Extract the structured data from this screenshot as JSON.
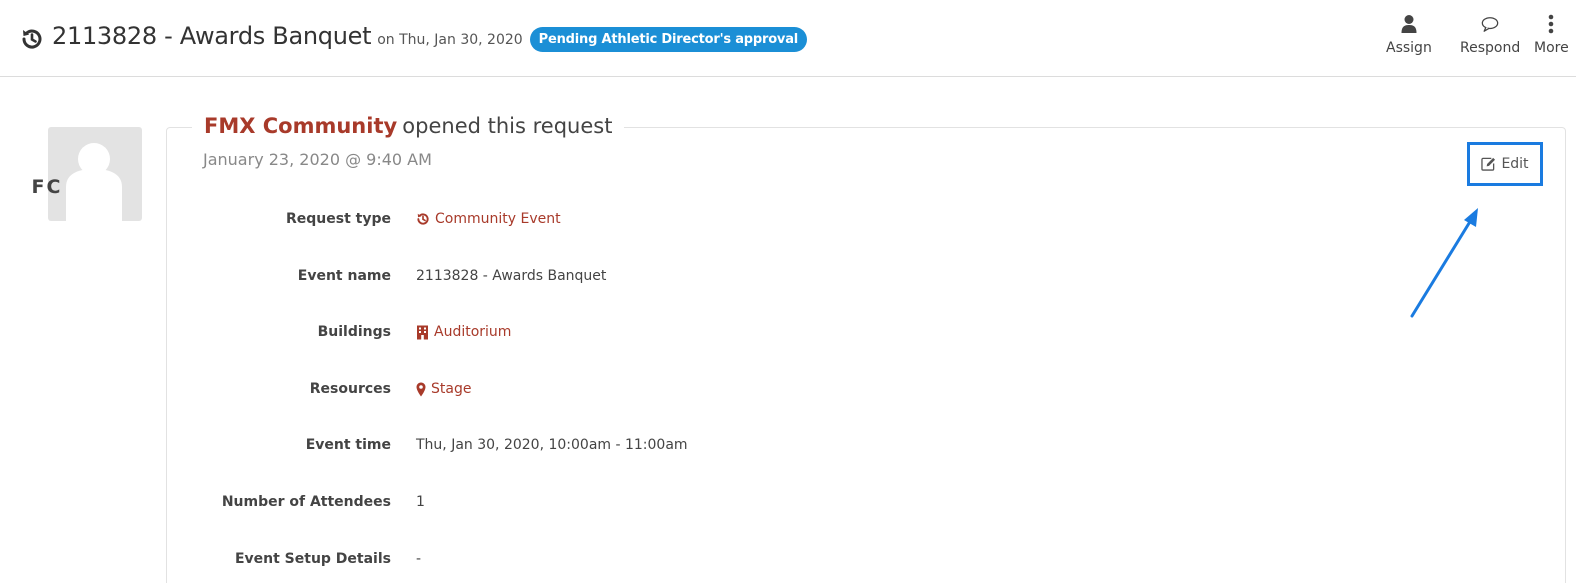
{
  "header": {
    "title": "2113828 - Awards Banquet",
    "date_text": "on Thu, Jan 30, 2020",
    "status": "Pending Athletic Director's approval",
    "status_color": "#1b8fd6",
    "icon": "history-icon"
  },
  "actions": [
    {
      "label": "Assign",
      "icon": "user-icon"
    },
    {
      "label": "Respond",
      "icon": "speech-bubble-icon"
    },
    {
      "label": "More",
      "icon": "vertical-ellipsis-icon"
    }
  ],
  "activity": {
    "avatar_initials": "FC",
    "author": "FMX Community",
    "action": "opened this request",
    "timestamp": "January 23, 2020 @ 9:40 AM",
    "edit_label": "Edit",
    "edit_icon": "edit-icon",
    "highlight_color": "#1a7be0"
  },
  "fields": [
    {
      "label": "Request type",
      "value": "Community Event",
      "icon": "history-icon",
      "link": true
    },
    {
      "label": "Event name",
      "value": "2113828 - Awards Banquet",
      "icon": "",
      "link": false
    },
    {
      "label": "Buildings",
      "value": "Auditorium",
      "icon": "building-icon",
      "link": true
    },
    {
      "label": "Resources",
      "value": "Stage",
      "icon": "map-marker-icon",
      "link": true
    },
    {
      "label": "Event time",
      "value": "Thu, Jan 30, 2020, 10:00am - 11:00am",
      "icon": "",
      "link": false
    },
    {
      "label": "Number of Attendees",
      "value": "1",
      "icon": "",
      "link": false
    },
    {
      "label": "Event Setup Details",
      "value": "-",
      "icon": "",
      "link": false
    }
  ],
  "colors": {
    "accent_link": "#a83a2a",
    "text": "#444444"
  }
}
